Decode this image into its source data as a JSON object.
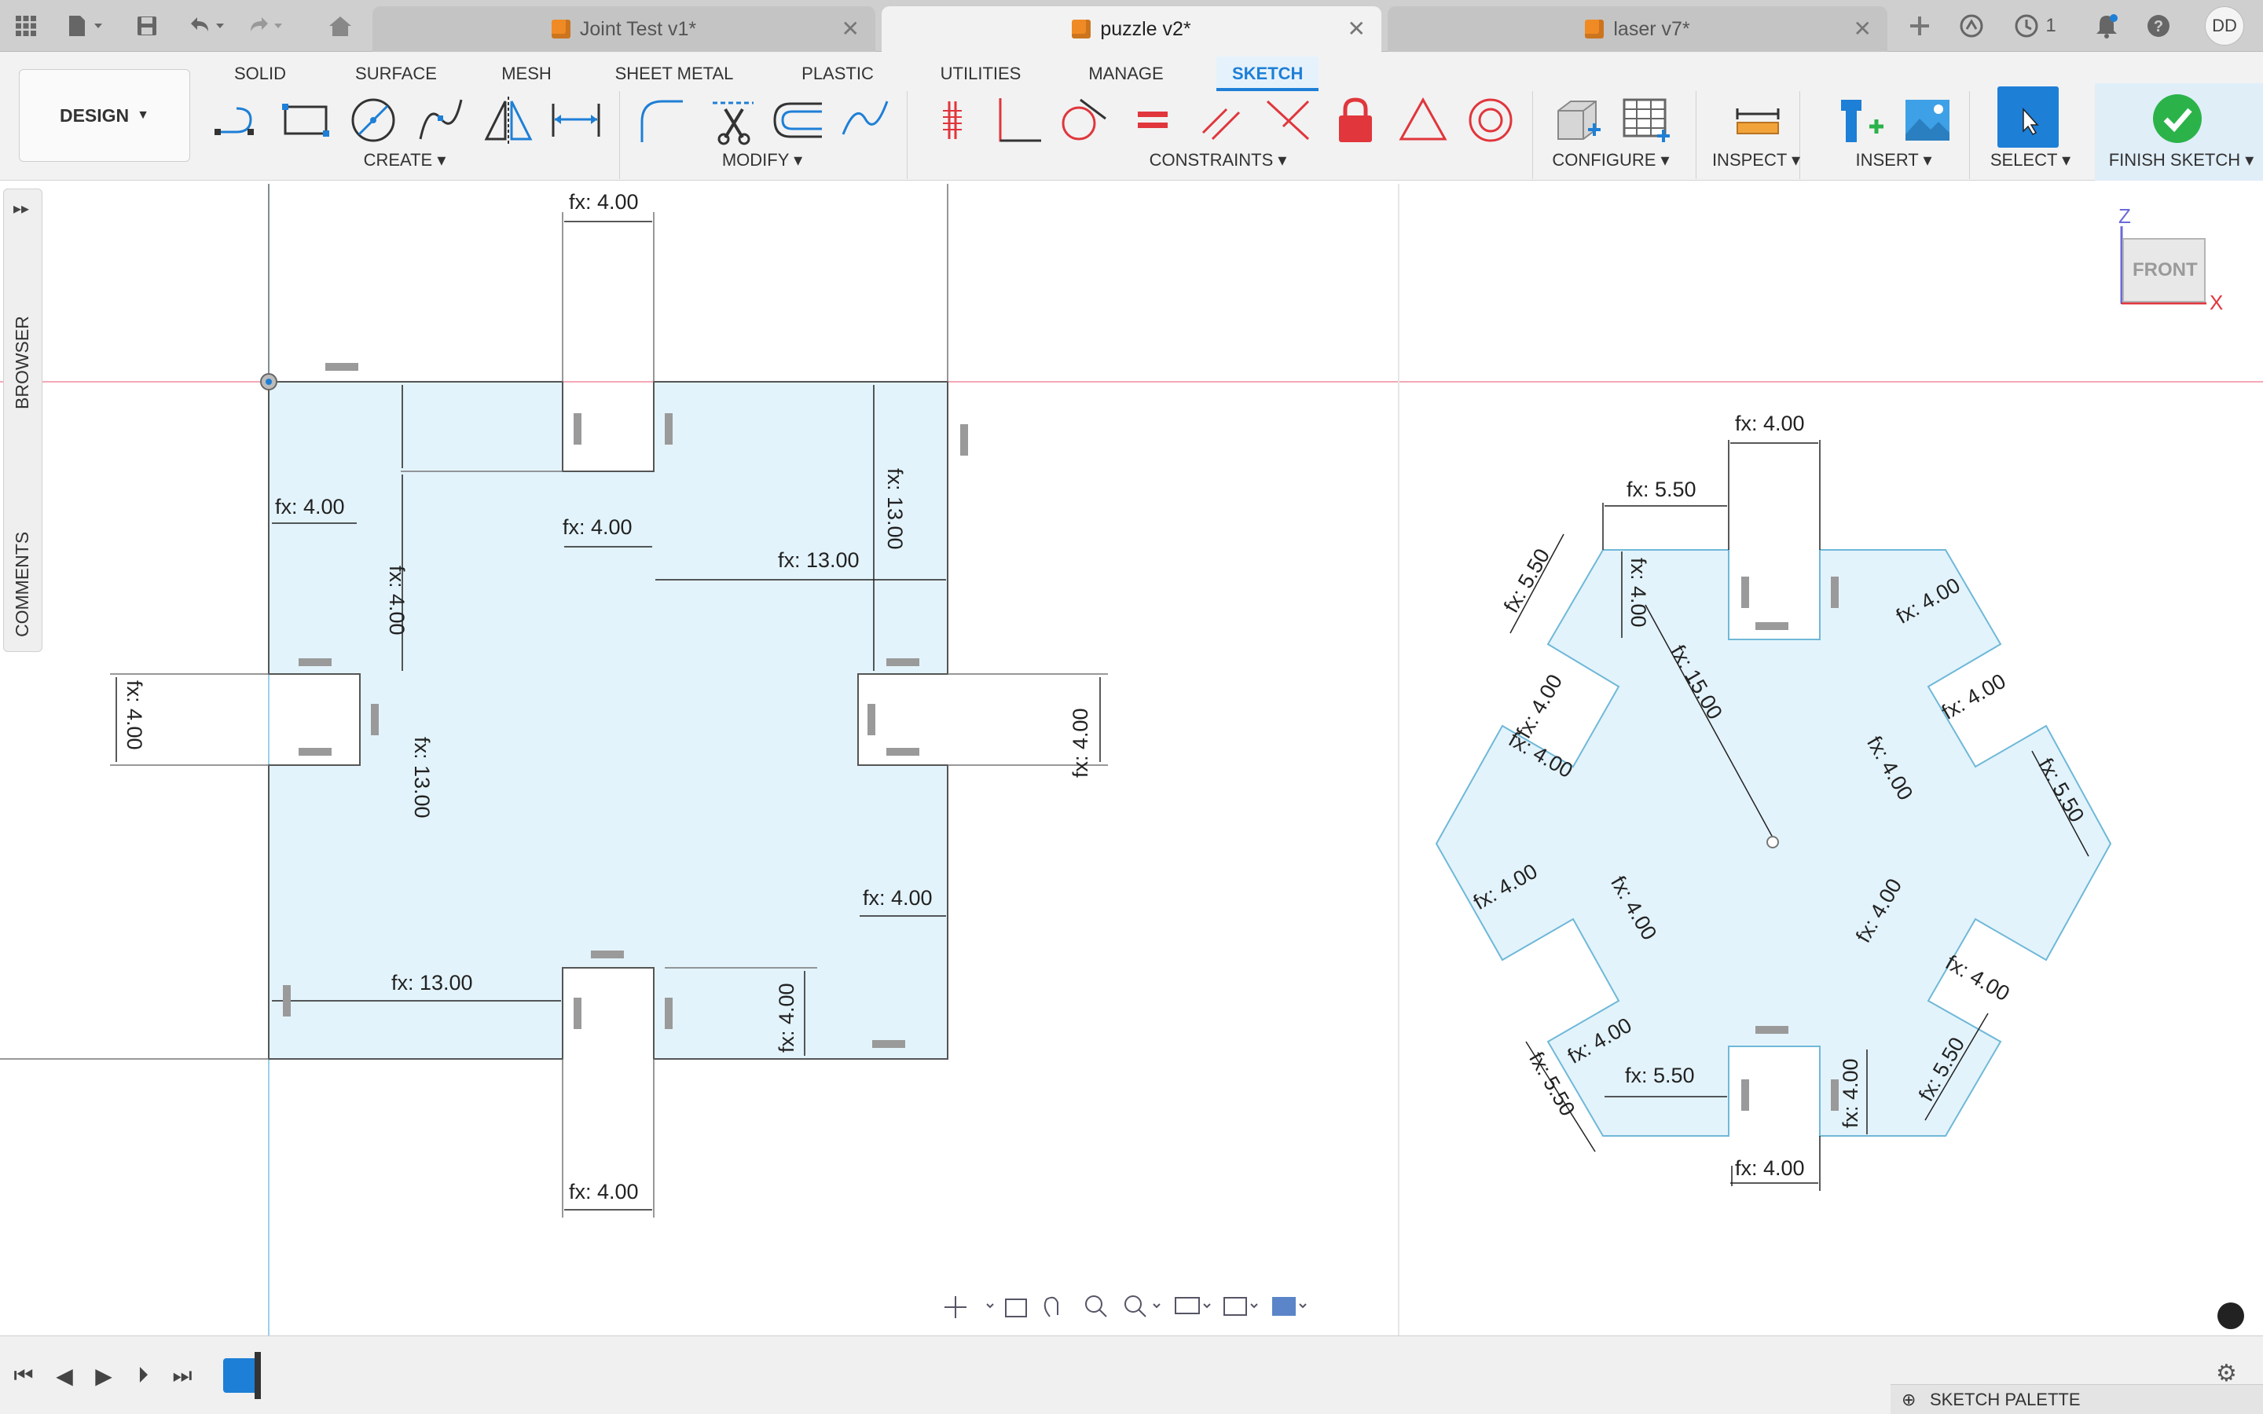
{
  "tabs": [
    {
      "label": "Joint Test v1*",
      "active": false
    },
    {
      "label": "puzzle v2*",
      "active": true
    },
    {
      "label": "laser v7*",
      "active": false
    }
  ],
  "tabbar_right": {
    "jobs_count": "1",
    "user_initials": "DD"
  },
  "workspace_button": "DESIGN",
  "menu_tabs": [
    "SOLID",
    "SURFACE",
    "MESH",
    "SHEET METAL",
    "PLASTIC",
    "UTILITIES",
    "MANAGE",
    "SKETCH"
  ],
  "tool_groups": {
    "create": "CREATE",
    "modify": "MODIFY",
    "constraints": "CONSTRAINTS",
    "configure": "CONFIGURE",
    "inspect": "INSPECT",
    "insert": "INSERT",
    "select": "SELECT",
    "finish": "FINISH SKETCH"
  },
  "side_panel": {
    "browser": "BROWSER",
    "comments": "COMMENTS"
  },
  "viewcube": {
    "face": "FRONT",
    "axis_z": "Z",
    "axis_x": "X"
  },
  "dimensions": {
    "left_top_gap": "fx: 4.00",
    "left_corner_v": "fx: 4.00",
    "left_corner_h": "fx: 4.00",
    "left_inner_v": "fx: 13.00",
    "left_notch_h": "fx: 4.00",
    "left_right_v": "fx: 13.00",
    "left_right_h": "fx: 13.00",
    "left_side_notch_l": "fx: 4.00",
    "left_side_notch_r": "fx: 4.00",
    "left_right_lower": "fx: 4.00",
    "left_bottom_h": "fx: 13.00",
    "left_bottom_v": "fx: 4.00",
    "left_bottom_gap": "fx: 4.00",
    "hex_top_gap": "fx: 4.00",
    "hex_top_550": "fx: 5.50",
    "hex_tl_550": "fx: 5.50",
    "hex_top_v": "fx: 4.00",
    "hex_radius": "fx: 15.00",
    "hex_notch_a": "fx: 4.00",
    "hex_notch_b": "fx: 4.00",
    "hex_r_a": "fx: 4.00",
    "hex_r_b": "fx: 4.00",
    "hex_r_c": "fx: 4.00",
    "hex_r_550": "fx: 5.50",
    "hex_l_a": "fx: 4.00",
    "hex_l_b": "fx: 4.00",
    "hex_br_a": "fx: 4.00",
    "hex_br_b": "fx: 4.00",
    "hex_bl_a": "fx: 4.00",
    "hex_bl_550": "fx: 5.50",
    "hex_bot_550": "fx: 5.50",
    "hex_bot_v": "fx: 4.00",
    "hex_br_550": "fx: 5.50",
    "hex_bot_gap": "fx: 4.00"
  },
  "sketch_palette": "SKETCH PALETTE",
  "colors": {
    "sketch_fill": "#e3f3fb",
    "sketch_line": "#6fb8d8",
    "accent": "#1e7fd6",
    "finish_green": "#2bb34a",
    "constraint_red": "#e0363c"
  }
}
